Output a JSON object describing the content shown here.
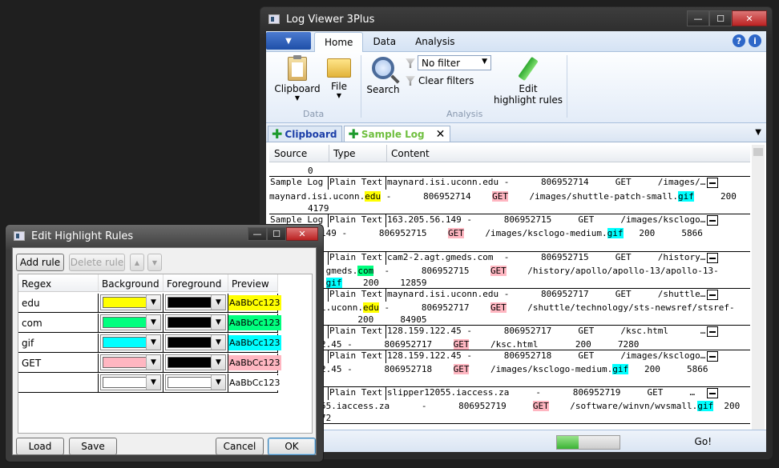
{
  "main_window": {
    "title": "Log Viewer 3Plus",
    "window_buttons": {
      "minimize": "—",
      "maximize": "☐",
      "close": "✕"
    },
    "ribbon_tabs": [
      "Home",
      "Data",
      "Analysis"
    ],
    "ribbon": {
      "clipboard_label": "Clipboard",
      "file_label": "File",
      "group_data": "Data",
      "search_label": "Search",
      "filter_value": "No filter",
      "clear_filters_label": "Clear filters",
      "group_analysis": "Analysis",
      "edit_rules_line1": "Edit",
      "edit_rules_line2": "highlight rules",
      "help": "?",
      "info": "i"
    },
    "doc_tabs": {
      "clipboard": "Clipboard",
      "sample": "Sample Log",
      "close": "✕"
    },
    "columns": [
      "Source",
      "Type",
      "Content"
    ],
    "summary_rows": [
      {
        "source": "Sample Log",
        "type": "Plain Text",
        "content": "maynard.isi.uconn.edu -      806952714     GET     /images/…"
      },
      {
        "source": "Sample Log",
        "type": "Plain Text",
        "content": "163.205.56.149 -      806952715     GET     /images/ksclogo…"
      },
      {
        "source": "",
        "type": "Plain Text",
        "content": "cam2-2.agt.gmeds.com  -      806952715     GET     /history…"
      },
      {
        "source": "",
        "type": "Plain Text",
        "content": "maynard.isi.uconn.edu -      806952717     GET     /shuttle…"
      },
      {
        "source": "",
        "type": "Plain Text",
        "content": "128.159.122.45 -      806952717     GET     /ksc.html      …"
      },
      {
        "source": "",
        "type": "Plain Text",
        "content": "128.159.122.45 -      806952718     GET     /images/ksclogo…"
      },
      {
        "source": "",
        "type": "Plain Text",
        "content": "slipper12055.iaccess.za     -      806952719     GET     …"
      },
      {
        "source": "",
        "type": "",
        "content": ""
      }
    ],
    "detail_lines": {
      "d0": "0",
      "d1a": "maynard.isi.uconn.",
      "d1b": "edu",
      "d1c": " -      806952714    ",
      "d1d": "GET",
      "d1e": "    /images/shuttle-patch-small.",
      "d1f": "gif",
      "d1g": "     200",
      "d1h": "4179",
      "d2a": "149 -      806952715    ",
      "d2b": "GET",
      "d2c": "    /images/ksclogo-medium.",
      "d2d": "gif",
      "d2e": "   200     5866",
      "d3a": ".gmeds.",
      "d3b": "com",
      "d3c": "  -      806952715    ",
      "d3d": "GET",
      "d3e": "    /history/apollo/apollo-13/apollo-13-",
      "d3f": ".",
      "d3g": "gif",
      "d3h": "    200    12859",
      "d4a": "i.uconn.",
      "d4b": "edu",
      "d4c": " -      806952717    ",
      "d4d": "GET",
      "d4e": "    /shuttle/technology/sts-newsref/stsref-",
      "d4f": "       200     84905",
      "d5a": "2.45 -      806952717    ",
      "d5b": "GET",
      "d5c": "    /ksc.html       200     7280",
      "d6a": "2.45 -      806952718    ",
      "d6b": "GET",
      "d6c": "    /images/ksclogo-medium.",
      "d6d": "gif",
      "d6e": "   200     5866",
      "d7a": "55.iaccess.za      -      806952719     ",
      "d7b": "GET",
      "d7c": "    /software/winvn/wvsmall.",
      "d7d": "gif",
      "d7e": "  200",
      "d7f": "72"
    },
    "status": {
      "go_label": "Go!",
      "progress": 0.35
    }
  },
  "dialog": {
    "title": "Edit Highlight Rules",
    "window_buttons": {
      "minimize": "—",
      "maximize": "☐",
      "close": "✕"
    },
    "toolbar": {
      "add": "Add rule",
      "delete": "Delete rule",
      "up": "▲",
      "down": "▼"
    },
    "columns": [
      "Regex",
      "Background",
      "Foreground",
      "Preview"
    ],
    "rules": [
      {
        "regex": "edu",
        "background": "#ffff00",
        "foreground": "#000000",
        "preview": "AaBbCc123"
      },
      {
        "regex": "com",
        "background": "#00ff7f",
        "foreground": "#000000",
        "preview": "AaBbCc123"
      },
      {
        "regex": "gif",
        "background": "#00ffff",
        "foreground": "#000000",
        "preview": "AaBbCc123"
      },
      {
        "regex": "GET",
        "background": "#ffb6c1",
        "foreground": "#000000",
        "preview": "AaBbCc123"
      },
      {
        "regex": "",
        "background": "#ffffff",
        "foreground": "#ffffff",
        "preview": "AaBbCc123"
      }
    ],
    "buttons": {
      "load": "Load",
      "save": "Save",
      "cancel": "Cancel",
      "ok": "OK"
    }
  }
}
